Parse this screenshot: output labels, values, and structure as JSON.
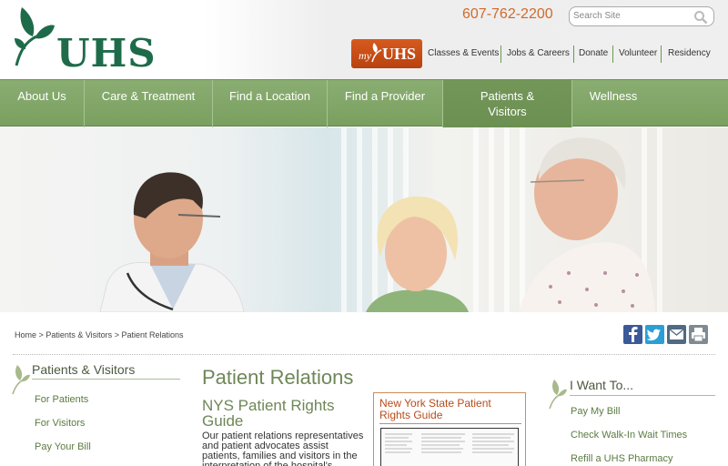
{
  "header": {
    "logo_text": "UHS",
    "phone": "607-762-2200",
    "search_placeholder": "Search Site",
    "myuhs": {
      "my": "my",
      "uhs": "UHS"
    },
    "utility_links": [
      "Classes & Events",
      "Jobs & Careers",
      "Donate",
      "Volunteer",
      "Residency"
    ]
  },
  "nav": {
    "items": [
      {
        "label": "About Us"
      },
      {
        "label": "Care & Treatment"
      },
      {
        "label": "Find a Location"
      },
      {
        "label": "Find a Provider"
      },
      {
        "label": "Patients & Visitors",
        "active": true
      },
      {
        "label": "Wellness"
      }
    ]
  },
  "breadcrumb": [
    "Home",
    "Patients & Visitors",
    "Patient Relations"
  ],
  "breadcrumb_sep": ">",
  "social_icons": [
    "facebook-icon",
    "twitter-icon",
    "email-icon",
    "print-icon"
  ],
  "left_sidebar": {
    "title": "Patients & Visitors",
    "links": [
      "For Patients",
      "For Visitors",
      "Pay Your Bill"
    ]
  },
  "main": {
    "title": "Patient Relations",
    "subtitle": "NYS Patient Rights Guide",
    "body": "Our patient relations representatives and patient advocates assist patients, families and visitors in the interpretation of the hospital's",
    "card_title": "New York State Patient Rights Guide"
  },
  "right_sidebar": {
    "title": "I Want To...",
    "links": [
      "Pay My Bill",
      "Check Walk-In Wait Times",
      "Refill a UHS Pharmacy"
    ]
  },
  "colors": {
    "brand_green": "#1e6b4a",
    "nav_green": "#7fa466",
    "accent_orange": "#d06a2b"
  }
}
